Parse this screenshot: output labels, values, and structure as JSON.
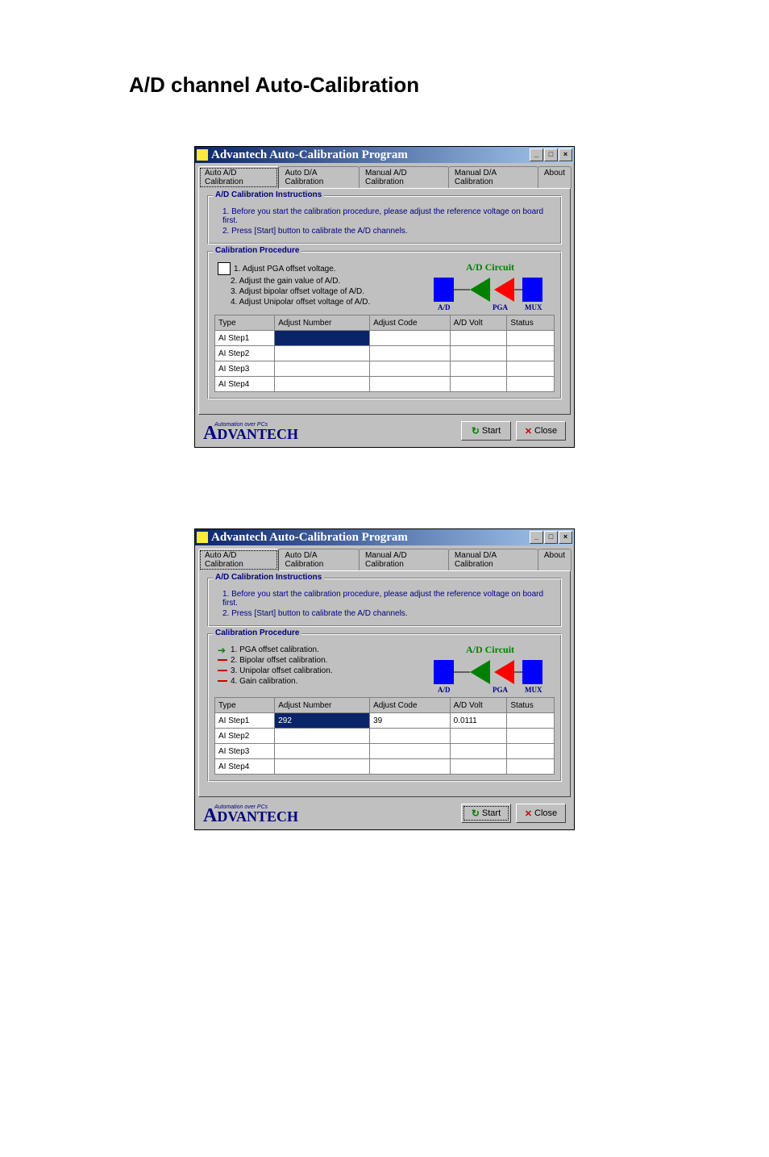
{
  "page_title": "A/D channel Auto-Calibration",
  "tabs": [
    "Auto A/D Calibration",
    "Auto D/A Calibration",
    "Manual A/D Calibration",
    "Manual D/A Calibration",
    "About"
  ],
  "active_tab": "Auto A/D Calibration",
  "window": {
    "title": "Advantech Auto-Calibration Program",
    "minimize": "_",
    "maximize": "□",
    "close": "×"
  },
  "instructions": {
    "title": "A/D Calibration Instructions",
    "line1": "1. Before you start the calibration procedure, please adjust the reference voltage on board first.",
    "line2": "2. Press [Start] button to calibrate the A/D channels."
  },
  "procedure_title": "Calibration Procedure",
  "circuit": {
    "title": "A/D Circuit",
    "labels": [
      "A/D",
      "PGA",
      "MUX"
    ]
  },
  "screenshot1": {
    "steps": [
      "1. Adjust PGA offset voltage.",
      "2. Adjust the gain value of A/D.",
      "3. Adjust bipolar offset voltage of A/D.",
      "4. Adjust Unipolar offset voltage of A/D."
    ],
    "columns": [
      "Type",
      "Adjust Number",
      "Adjust Code",
      "A/D Volt",
      "Status"
    ],
    "rows": [
      {
        "type": "AI Step1",
        "adjust_number": "",
        "adjust_code": "",
        "ad_volt": "",
        "status": "",
        "highlight_num": true
      },
      {
        "type": "AI Step2",
        "adjust_number": "",
        "adjust_code": "",
        "ad_volt": "",
        "status": ""
      },
      {
        "type": "AI Step3",
        "adjust_number": "",
        "adjust_code": "",
        "ad_volt": "",
        "status": ""
      },
      {
        "type": "AI Step4",
        "adjust_number": "",
        "adjust_code": "",
        "ad_volt": "",
        "status": ""
      }
    ]
  },
  "screenshot2": {
    "steps": [
      "1. PGA offset calibration.",
      "2. Bipolar offset calibration.",
      "3. Unipolar offset calibration.",
      "4. Gain calibration."
    ],
    "columns": [
      "Type",
      "Adjust Number",
      "Adjust Code",
      "A/D Volt",
      "Status"
    ],
    "rows": [
      {
        "type": "AI Step1",
        "adjust_number": "292",
        "adjust_code": "39",
        "ad_volt": "0.0111",
        "status": "",
        "highlight_num": true
      },
      {
        "type": "AI Step2",
        "adjust_number": "",
        "adjust_code": "",
        "ad_volt": "",
        "status": ""
      },
      {
        "type": "AI Step3",
        "adjust_number": "",
        "adjust_code": "",
        "ad_volt": "",
        "status": ""
      },
      {
        "type": "AI Step4",
        "adjust_number": "",
        "adjust_code": "",
        "ad_volt": "",
        "status": ""
      }
    ]
  },
  "logo": {
    "sub": "Automation over PCs",
    "main_a": "A",
    "main_rest": "DVANTECH"
  },
  "buttons": {
    "start": "Start",
    "close": "Close"
  }
}
